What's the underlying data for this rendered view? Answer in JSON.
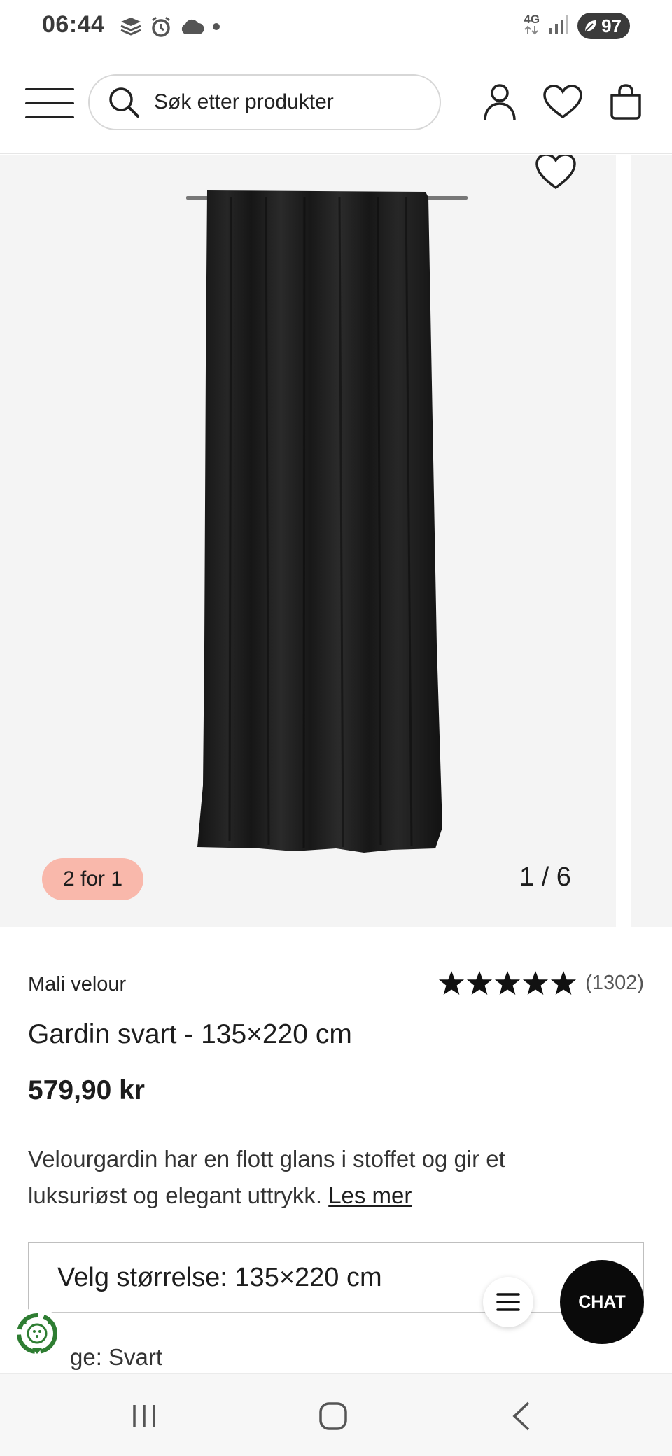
{
  "status_bar": {
    "time": "06:44",
    "network": "4G",
    "battery": "97",
    "icons": [
      "gallery-icon",
      "alarm-icon",
      "cloud-icon",
      "dot-icon",
      "signal-icon",
      "battery-leaf-icon"
    ]
  },
  "header": {
    "search_placeholder": "Søk etter produkter",
    "icons": [
      "menu-icon",
      "search-icon",
      "account-icon",
      "heart-icon",
      "bag-icon"
    ]
  },
  "gallery": {
    "promo_badge": "2 for 1",
    "pager": "1 / 6"
  },
  "product": {
    "brand": "Mali velour",
    "rating_stars": 5,
    "rating_count": "(1302)",
    "title": "Gardin svart - 135×220 cm",
    "price": "579,90 kr",
    "description": "Velourgardin har en flott glans i stoffet og gir et luksuriøst og elegant uttrykk.",
    "read_more": "Les mer",
    "size_label": "Velg størrelse: 135×220 cm",
    "color_label_partial": "ge:",
    "color_value": "Svart"
  },
  "floating": {
    "chat_label": "CHAT"
  },
  "colors": {
    "promo_badge_bg": "#f9b8ab",
    "chat_bg": "#0a0a0a",
    "eco_green": "#2e7d32",
    "gallery_bg": "#f4f4f4"
  }
}
